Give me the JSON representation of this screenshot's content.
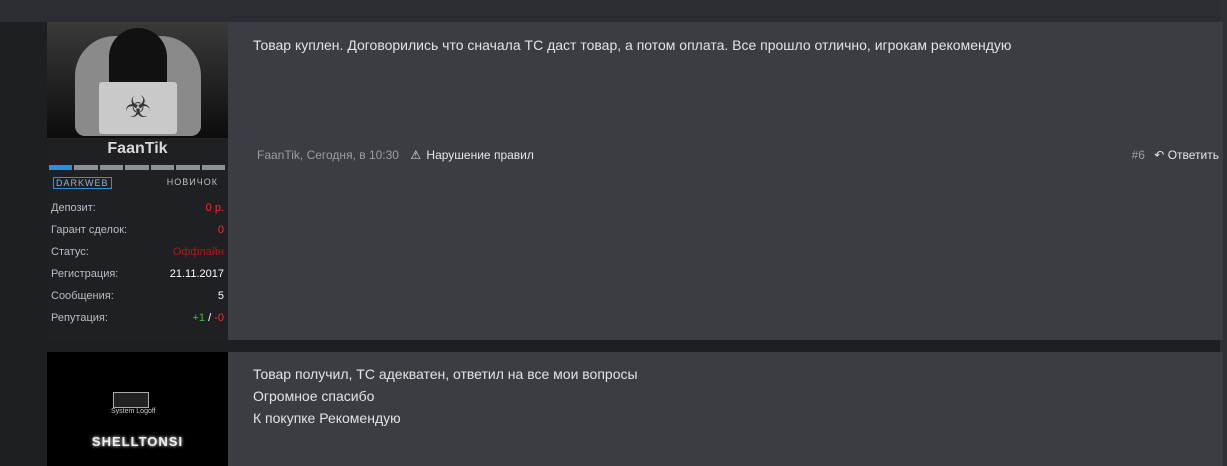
{
  "posts": [
    {
      "username": "FaanTik",
      "rank_left": "DARKWEB",
      "rank_right": "НОВИЧОК",
      "rank_progress": 0.14,
      "stats": {
        "deposit_label": "Депозит:",
        "deposit_value": "0 р.",
        "deals_label": "Гарант сделок:",
        "deals_value": "0",
        "status_label": "Статус:",
        "status_value": "Оффлайн",
        "reg_label": "Регистрация:",
        "reg_value": "21.11.2017",
        "msgs_label": "Сообщения:",
        "msgs_value": "5",
        "rep_label": "Репутация:",
        "rep_pos": "+1",
        "rep_sep": "/",
        "rep_neg": "-0"
      },
      "message": "Товар куплен. Договорились что сначала ТС даст товар, а потом оплата. Все прошло отлично, игрокам рекомендую",
      "meta_author_time": "FaanTik, Сегодня, в 10:30",
      "report_label": "Нарушение правил",
      "post_number": "#6",
      "reply_label": "Ответить"
    },
    {
      "avatar_caption": "System Logoff",
      "username": "SHELLTONSI",
      "message_lines": [
        "Товар получил, ТС адекватен, ответил на все мои вопросы",
        "Огромное спасибо",
        "К покупке Рекомендую"
      ]
    }
  ],
  "colors": {
    "background": "#1d1f22",
    "post_bg": "#3a3d42",
    "accent_blue": "#2f8fd6",
    "negative_red": "#ff2a2a",
    "positive_green": "#35c13a"
  },
  "icons": [
    "warning-icon",
    "reply-icon",
    "biohazard-icon"
  ]
}
